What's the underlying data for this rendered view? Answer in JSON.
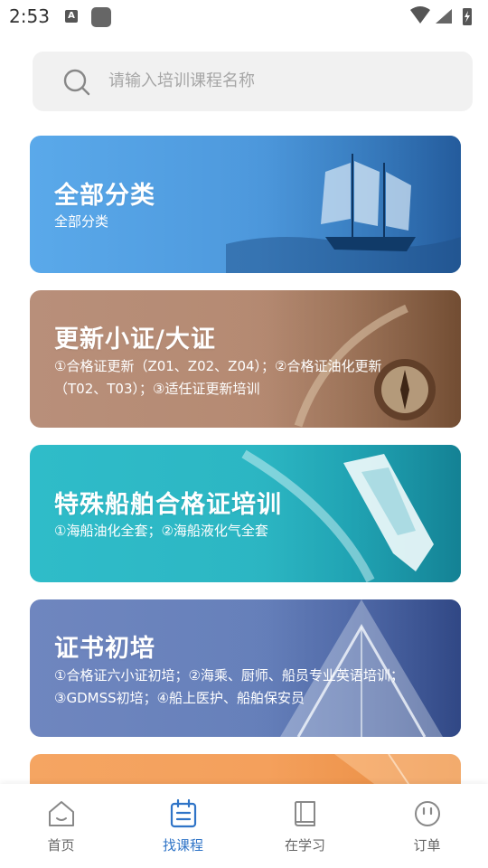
{
  "status_bar": {
    "time": "2:53",
    "notif_badge": "A"
  },
  "search": {
    "placeholder": "请输入培训课程名称"
  },
  "cards": [
    {
      "title": "全部分类",
      "desc": "全部分类"
    },
    {
      "title": "更新小证/大证",
      "desc": "①合格证更新（Z01、Z02、Z04）；②合格证油化更新（T02、T03）；③适任证更新培训"
    },
    {
      "title": "特殊船舶合格证培训",
      "desc": "①海船油化全套；②海船液化气全套"
    },
    {
      "title": "证书初培",
      "desc": "①合格证六小证初培；②海乘、厨师、船员专业英语培训；③GDMSS初培；④船上医护、船舶保安员"
    }
  ],
  "nav": [
    {
      "label": "首页",
      "icon": "home-icon"
    },
    {
      "label": "找课程",
      "icon": "calendar-icon",
      "active": true
    },
    {
      "label": "在学习",
      "icon": "book-icon"
    },
    {
      "label": "订单",
      "icon": "face-icon"
    }
  ],
  "colors": {
    "accent": "#2f74c7",
    "nav_inactive": "#666666"
  }
}
